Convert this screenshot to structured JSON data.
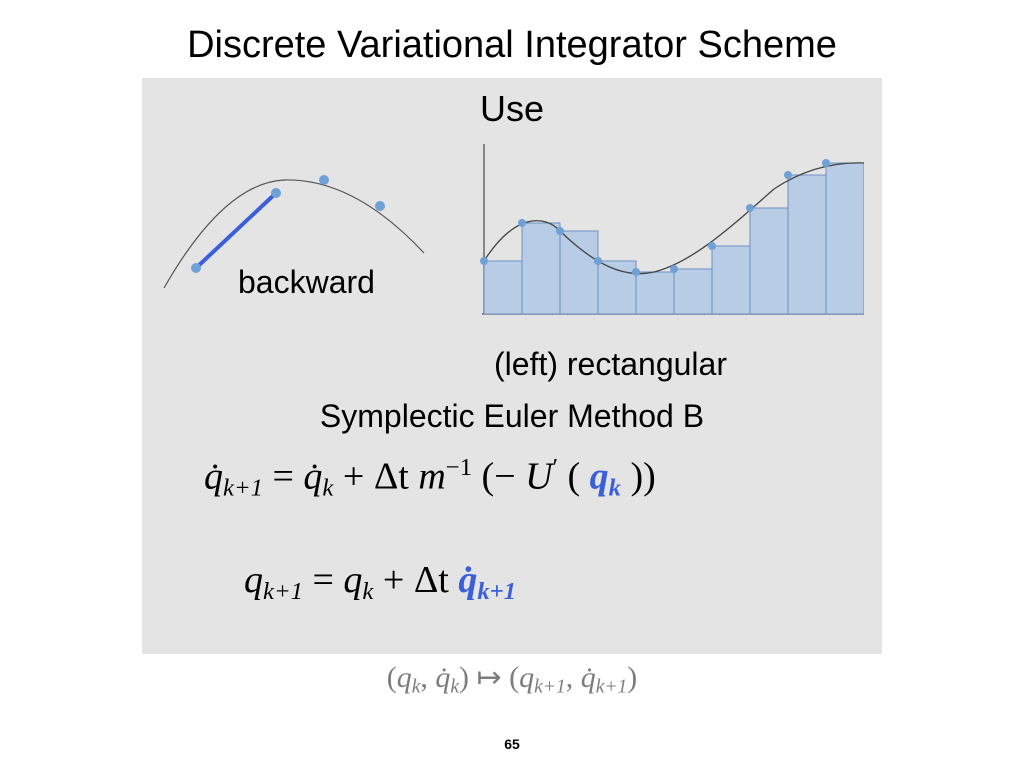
{
  "title": "Discrete Variational Integrator Scheme",
  "panel": {
    "use": "Use",
    "backward": "backward",
    "rectangular": "(left) rectangular",
    "symplectic": "Symplectic Euler Method B"
  },
  "equations": {
    "eq1_lhs_base": "q̇",
    "eq1_lhs_sub": "k+1",
    "eq1_eq": " = ",
    "eq1_rhs1_base": "q̇",
    "eq1_rhs1_sub": "k",
    "eq1_plus": " + ",
    "eq1_dt": "Δt ",
    "eq1_m": "m",
    "eq1_m_exp": "−1",
    "eq1_open": "(−",
    "eq1_U": "U",
    "eq1_prime": "′",
    "eq1_paren_open": "(",
    "eq1_qk_base": "q",
    "eq1_qk_sub": "k",
    "eq1_close": "))",
    "eq2_lhs_base": "q",
    "eq2_lhs_sub": "k+1",
    "eq2_eq": " = ",
    "eq2_rhs1_base": "q",
    "eq2_rhs1_sub": "k",
    "eq2_plus": " + ",
    "eq2_dt": "Δt ",
    "eq2_qd_base": "q̇",
    "eq2_qd_sub": "k+1"
  },
  "mapsto": {
    "open1": "(",
    "q1": "q",
    "q1_sub": "k",
    "sep1": ", ",
    "qd1": "q̇",
    "qd1_sub": "k",
    "close1": ")",
    "map": " ↦ ",
    "open2": "(",
    "q2": "q",
    "q2_sub": "k+1",
    "sep2": ", ",
    "qd2": "q̇",
    "qd2_sub": "k+1",
    "close2": ")"
  },
  "page_number": "65",
  "chart_data": [
    {
      "type": "line",
      "title": "backward difference (chord)",
      "description": "Curve with sample points; backward chord (blue segment) drawn between two lower-left sample points.",
      "x": [
        0,
        1,
        2,
        3,
        4
      ],
      "y": [
        0.1,
        0.45,
        0.95,
        1.0,
        0.8
      ],
      "chord_segment": {
        "from_index": 0,
        "to_index": 1
      },
      "xlabel": "",
      "ylabel": ""
    },
    {
      "type": "bar",
      "title": "(left) rectangular rule",
      "description": "Left-Riemann-sum rectangles under a wavy curve; bar heights equal curve value at left edge of each bin.",
      "categories": [
        "0",
        "1",
        "2",
        "3",
        "4",
        "5",
        "6",
        "7",
        "8",
        "9"
      ],
      "values": [
        0.35,
        0.6,
        0.55,
        0.35,
        0.28,
        0.3,
        0.45,
        0.7,
        0.92,
        1.0
      ],
      "xlabel": "",
      "ylabel": "",
      "ylim": [
        0,
        1.0
      ]
    }
  ]
}
